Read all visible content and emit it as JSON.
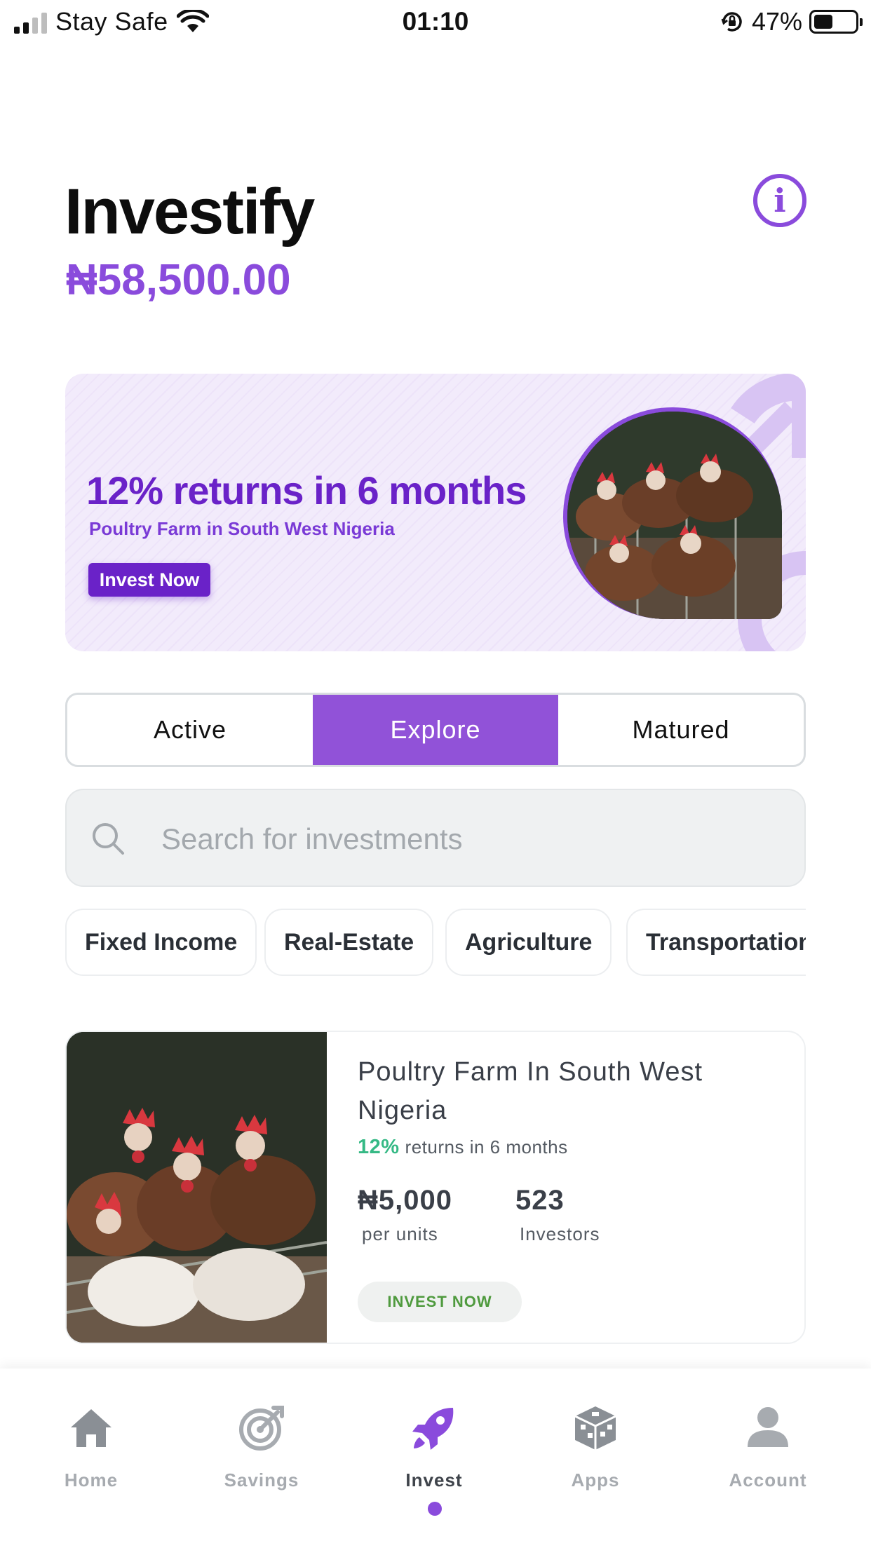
{
  "status_bar": {
    "carrier": "Stay Safe",
    "time": "01:10",
    "battery_percent": "47%",
    "battery_level": 0.47,
    "icons": [
      "signal-icon",
      "wifi-icon",
      "orientation-lock-icon",
      "battery-icon"
    ]
  },
  "header": {
    "title": "Investify",
    "balance": "₦58,500.00",
    "info_icon": "info-icon"
  },
  "banner": {
    "headline": "12% returns in 6 months",
    "subtitle": "Poultry Farm in South West Nigeria",
    "button_label": "Invest Now"
  },
  "tabs": [
    {
      "label": "Active",
      "selected": false
    },
    {
      "label": "Explore",
      "selected": true
    },
    {
      "label": "Matured",
      "selected": false
    }
  ],
  "search": {
    "placeholder": "Search for investments"
  },
  "categories": [
    "Fixed Income",
    "Real-Estate",
    "Agriculture",
    "Transportation"
  ],
  "investments": [
    {
      "title": "Poultry Farm In South West Nigeria",
      "returns_pct": "12%",
      "returns_text": "returns in 6 months",
      "price": "₦5,000",
      "price_label": "per units",
      "investors": "523",
      "investors_label": "Investors",
      "button_label": "INVEST NOW"
    }
  ],
  "bottom_nav": {
    "items": [
      {
        "label": "Home",
        "icon": "home-icon"
      },
      {
        "label": "Savings",
        "icon": "target-icon"
      },
      {
        "label": "Invest",
        "icon": "rocket-icon",
        "active": true
      },
      {
        "label": "Apps",
        "icon": "cube-icon"
      },
      {
        "label": "Account",
        "icon": "user-icon"
      }
    ]
  },
  "colors": {
    "accent": "#8a4bdc",
    "banner_purple": "#6a22c8",
    "returns_green": "#35b985",
    "invest_green": "#4f9a3e"
  }
}
